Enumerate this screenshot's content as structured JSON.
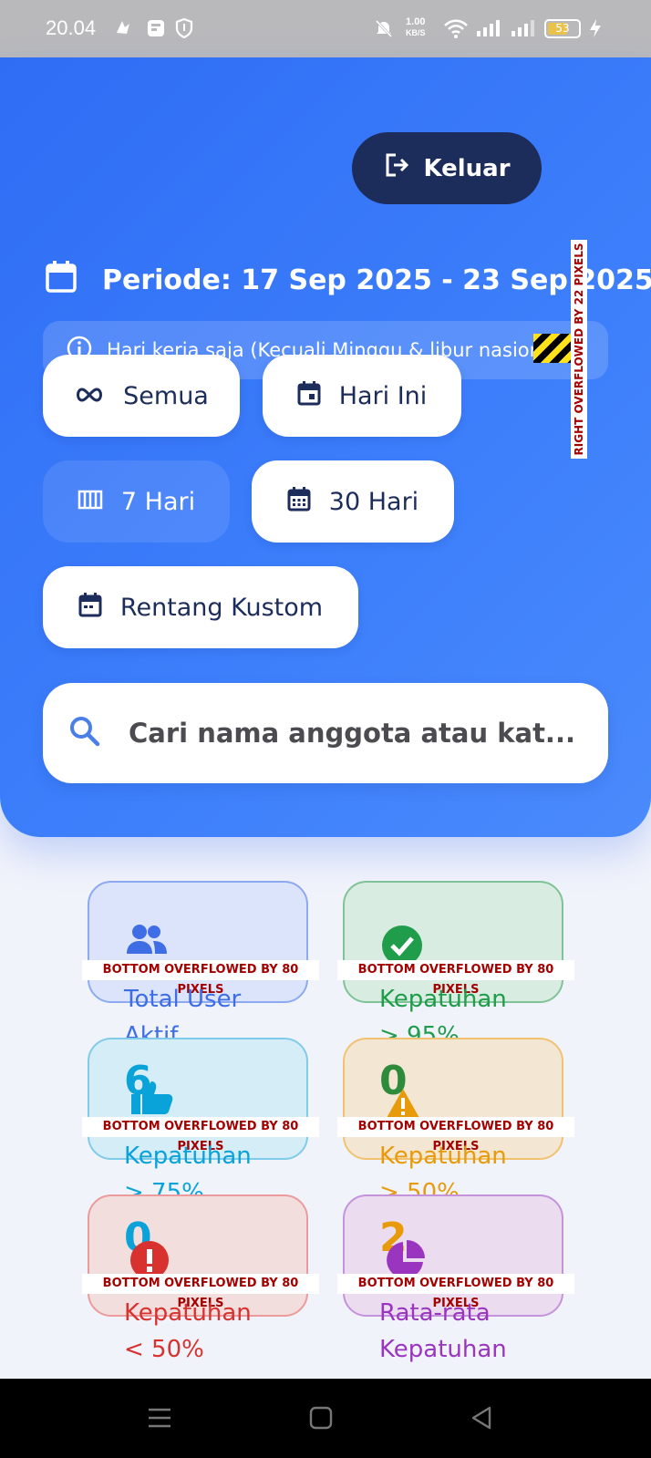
{
  "status": {
    "time": "20.04",
    "net_speed_value": "1.00",
    "net_speed_unit": "KB/S",
    "battery": "53"
  },
  "header": {
    "logout_label": "Keluar",
    "period_text": "Periode: 17 Sep 2025 - 23 Sep 2025",
    "note_text": "Hari kerja saja (Kecuali Minggu & libur nasional)",
    "overflow_right": "RIGHT OVERFLOWED BY 22 PIXELS"
  },
  "filters": {
    "all": "Semua",
    "today": "Hari Ini",
    "days7": "7 Hari",
    "days30": "30 Hari",
    "custom": "Rentang Kustom",
    "active": "7 Hari"
  },
  "search": {
    "placeholder": "Cari nama anggota atau kat..."
  },
  "overflow_bottom": "BOTTOM OVERFLOWED BY 80 PIXELS",
  "cards": {
    "total_user": {
      "line1": "Total User",
      "line2": "Aktif",
      "color": "#3f6de6"
    },
    "comp95": {
      "line1": "Kepatuhan",
      "line2": "> 95%",
      "color": "#1f9d4a"
    },
    "comp75": {
      "number": "6",
      "line1": "Kepatuhan",
      "line2": "> 75%",
      "color": "#0aa3d9"
    },
    "comp50": {
      "number": "0",
      "line1": "Kepatuhan",
      "line2": "> 50%",
      "color": "#e79b0b"
    },
    "compLow": {
      "number": "0",
      "line1": "Kepatuhan",
      "line2": "< 50%",
      "color": "#d7322f"
    },
    "avg": {
      "number": "2",
      "line1": "Rata-rata",
      "line2": "Kepatuhan",
      "color": "#9a35c0"
    }
  }
}
